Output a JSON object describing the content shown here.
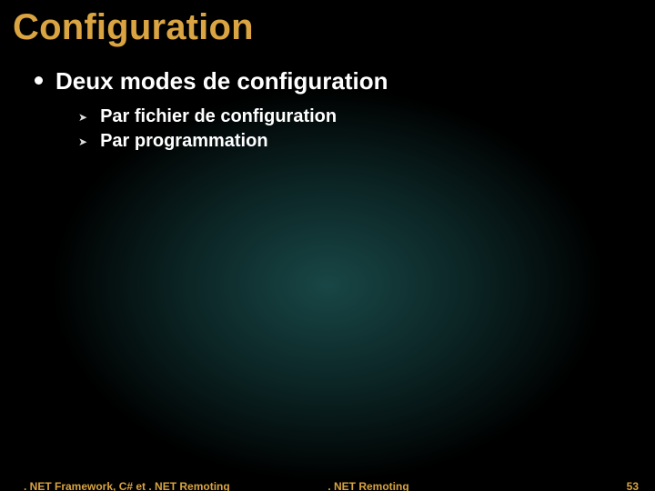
{
  "colors": {
    "accent": "#d9a441"
  },
  "title": "Configuration",
  "bullets": {
    "main": "Deux modes de configuration",
    "subs": [
      "Par fichier de configuration",
      "Par programmation"
    ]
  },
  "footer": {
    "left": ". NET Framework, C# et . NET Remoting",
    "center": ". NET Remoting",
    "page": "53"
  }
}
